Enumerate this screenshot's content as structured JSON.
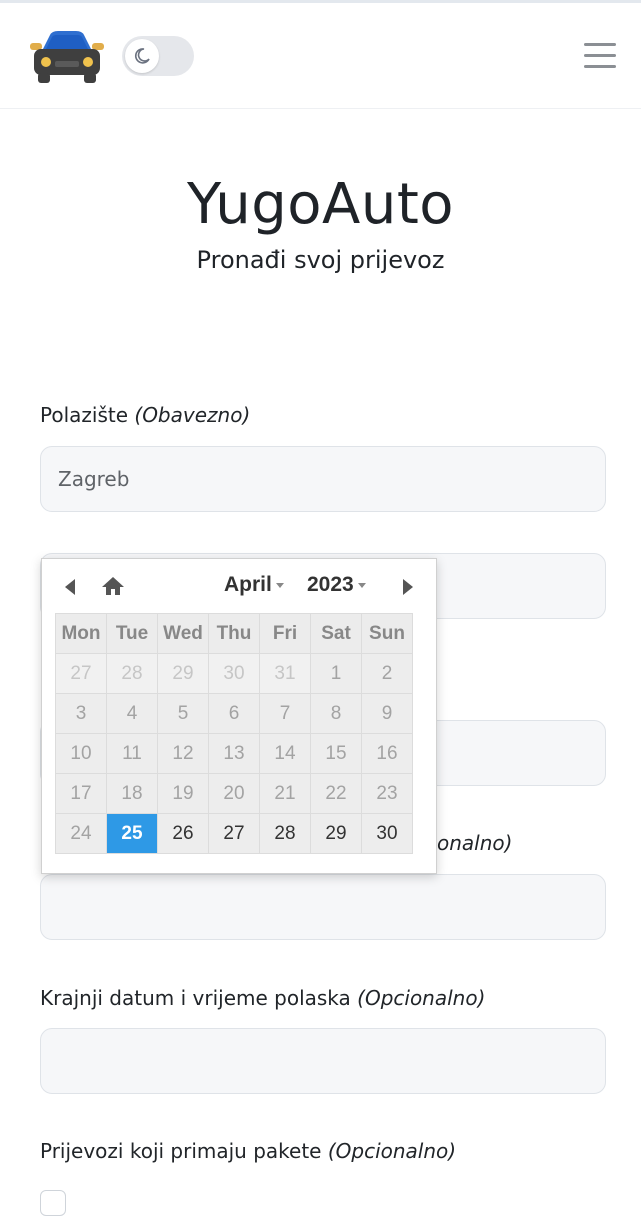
{
  "header": {
    "theme_toggle_icon": "moon-icon",
    "menu_icon": "hamburger-menu-icon",
    "logo_icon": "car-icon"
  },
  "hero": {
    "title": "YugoAuto",
    "subtitle": "Pronađi svoj prijevoz"
  },
  "form": {
    "departure": {
      "label": "Polazište",
      "hint": "(Obavezno)",
      "value": "Zagreb"
    },
    "start_hint_partial": "onalno)",
    "end_datetime": {
      "label": "Krajnji datum i vrijeme polaska",
      "hint": "(Opcionalno)",
      "value": ""
    },
    "packages": {
      "label": "Prijevozi koji primaju pakete",
      "hint": "(Opcionalno)"
    }
  },
  "datepicker": {
    "month": "April",
    "year": "2023",
    "weekdays": [
      "Mon",
      "Tue",
      "Wed",
      "Thu",
      "Fri",
      "Sat",
      "Sun"
    ],
    "weeks": [
      [
        {
          "d": "27",
          "s": "other"
        },
        {
          "d": "28",
          "s": "other"
        },
        {
          "d": "29",
          "s": "other"
        },
        {
          "d": "30",
          "s": "other"
        },
        {
          "d": "31",
          "s": "other"
        },
        {
          "d": "1",
          "s": "past"
        },
        {
          "d": "2",
          "s": "past"
        }
      ],
      [
        {
          "d": "3",
          "s": "past"
        },
        {
          "d": "4",
          "s": "past"
        },
        {
          "d": "5",
          "s": "past"
        },
        {
          "d": "6",
          "s": "past"
        },
        {
          "d": "7",
          "s": "past"
        },
        {
          "d": "8",
          "s": "past"
        },
        {
          "d": "9",
          "s": "past"
        }
      ],
      [
        {
          "d": "10",
          "s": "past"
        },
        {
          "d": "11",
          "s": "past"
        },
        {
          "d": "12",
          "s": "past"
        },
        {
          "d": "13",
          "s": "past"
        },
        {
          "d": "14",
          "s": "past"
        },
        {
          "d": "15",
          "s": "past"
        },
        {
          "d": "16",
          "s": "past"
        }
      ],
      [
        {
          "d": "17",
          "s": "past"
        },
        {
          "d": "18",
          "s": "past"
        },
        {
          "d": "19",
          "s": "past"
        },
        {
          "d": "20",
          "s": "past"
        },
        {
          "d": "21",
          "s": "past"
        },
        {
          "d": "22",
          "s": "past"
        },
        {
          "d": "23",
          "s": "past"
        }
      ],
      [
        {
          "d": "24",
          "s": "past"
        },
        {
          "d": "25",
          "s": "today"
        },
        {
          "d": "26",
          "s": "avail"
        },
        {
          "d": "27",
          "s": "avail"
        },
        {
          "d": "28",
          "s": "avail"
        },
        {
          "d": "29",
          "s": "avail"
        },
        {
          "d": "30",
          "s": "avail"
        }
      ]
    ],
    "colors": {
      "today": "#2e99e6"
    }
  }
}
